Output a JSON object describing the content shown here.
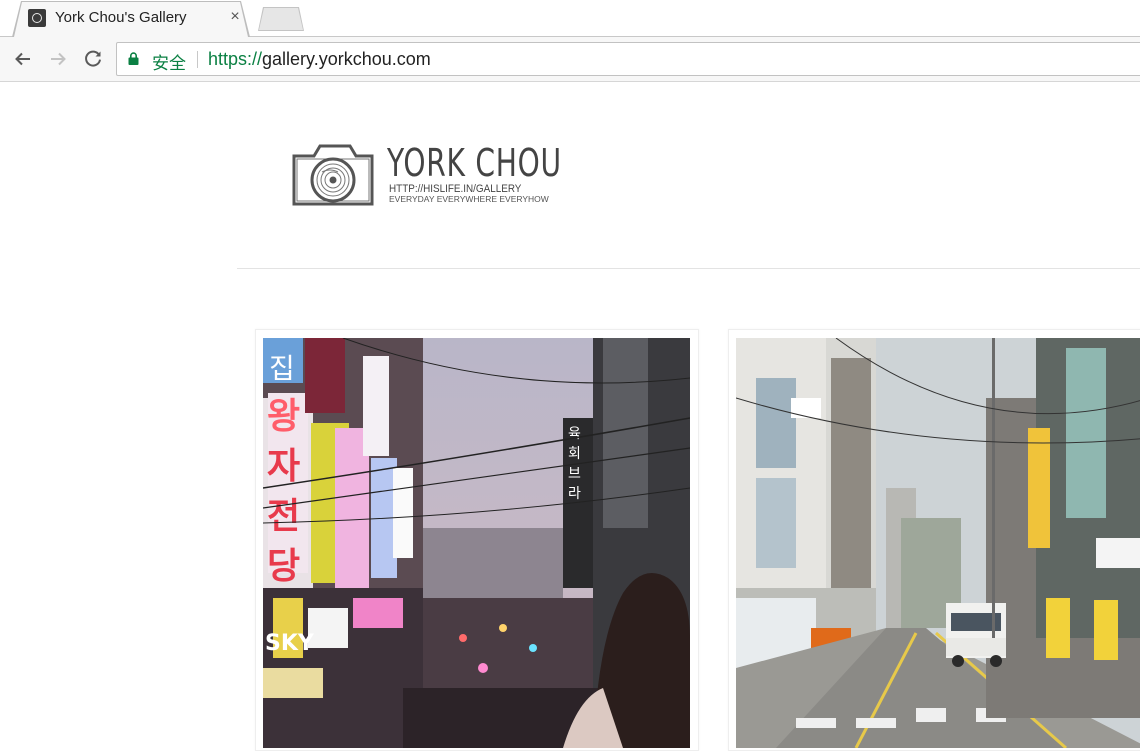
{
  "browser": {
    "tab": {
      "title": "York Chou's Gallery",
      "close_glyph": "×",
      "icon": "camera-favicon-icon"
    },
    "address_bar": {
      "security_label": "安全",
      "url_scheme": "https://",
      "url_host": "gallery.yorkchou.com"
    },
    "colors": {
      "secure_green": "#0b8043"
    }
  },
  "header": {
    "logo_title": "YORK CHOU",
    "logo_url": "HTTP://HISLIFE.IN/GALLERY",
    "logo_tagline": "EVERYDAY EVERYWHERE EVERYHOW"
  },
  "gallery": {
    "photos": [
      {
        "subject": "neon-signs-street-photo"
      },
      {
        "subject": "residential-street-truck-photo"
      }
    ]
  }
}
